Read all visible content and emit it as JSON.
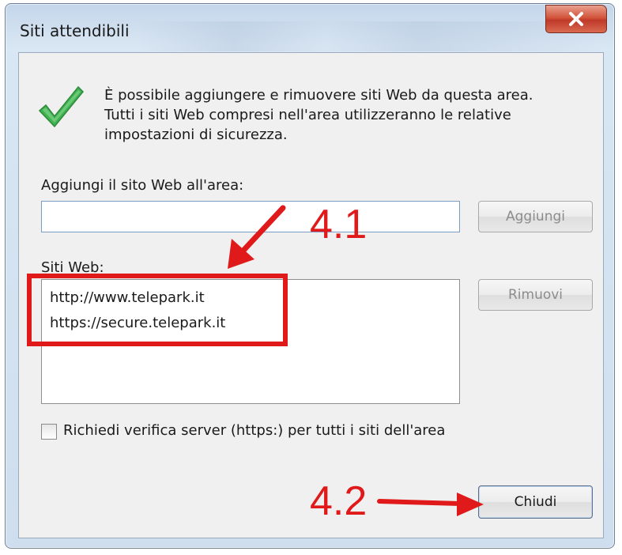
{
  "dialog": {
    "title": "Siti attendibili",
    "close_glyph": "X",
    "icon": "green-checkmark-icon",
    "description": [
      "È possibile aggiungere e rimuovere siti Web da questa area.",
      "Tutti i siti Web compresi nell'area utilizzeranno le relative",
      "impostazioni di sicurezza."
    ]
  },
  "add_site": {
    "label": "Aggiungi il sito Web all'area:",
    "value": "",
    "button_label": "Aggiungi"
  },
  "websites": {
    "label": "Siti Web:",
    "items": [
      "http://www.telepark.it",
      "https://secure.telepark.it"
    ],
    "remove_label": "Rimuovi"
  },
  "require_https": {
    "label": "Richiedi verifica server (https:) per tutti i siti dell'area",
    "checked": false
  },
  "close_button": {
    "label": "Chiudi"
  },
  "annotations": {
    "step_1": "4.1",
    "step_2": "4.2",
    "color": "#e01a1a"
  },
  "colors": {
    "frame": "#cfdeee",
    "close_button": "#c0392b",
    "checkmark": "#3fb34f"
  }
}
